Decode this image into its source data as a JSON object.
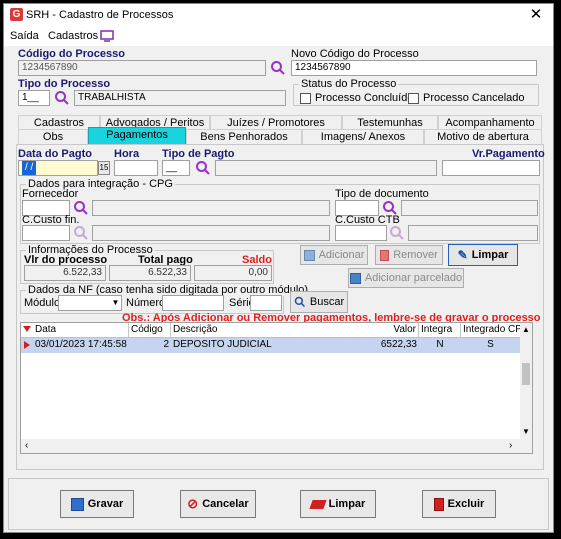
{
  "window": {
    "title": "SRH - Cadastro de Processos"
  },
  "menu": {
    "saida": "Saída",
    "cadastros": "Cadastros"
  },
  "header": {
    "codigo_label": "Código do Processo",
    "codigo_value": "1234567890",
    "novo_codigo_label": "Novo Código do Processo",
    "novo_codigo_value": "1234567890",
    "tipo_label": "Tipo do Processo",
    "tipo_code": "1__",
    "tipo_desc": "TRABALHISTA",
    "status_label": "Status do Processo",
    "concluido_label": "Processo Concluído",
    "cancelado_label": "Processo Cancelado"
  },
  "tabs": {
    "row1": [
      "Cadastros",
      "Advogados / Peritos",
      "Juízes / Promotores",
      "Testemunhas",
      "Acompanhamento"
    ],
    "row2": [
      "Obs",
      "Pagamentos",
      "Bens Penhorados",
      "Imagens/ Anexos",
      "Motivo de abertura"
    ],
    "active": "Pagamentos"
  },
  "pagamento": {
    "data_label": "Data do Pagto",
    "data_value": "/ /",
    "cal_label": "15",
    "hora_label": "Hora",
    "tipo_label": "Tipo de Pagto",
    "tipo_value": "__",
    "vr_label": "Vr.Pagamento",
    "cpg_group": "Dados para integração - CPG",
    "fornecedor_label": "Fornecedor",
    "tipo_doc_label": "Tipo de documento",
    "ccusto_fin_label": "C.Custo fin.",
    "ccusto_ctb_label": "C.Custo CTB"
  },
  "info": {
    "group": "Informações do Processo",
    "vlr_label": "Vlr do processo",
    "vlr_value": "6.522,33",
    "total_label": "Total pago",
    "total_value": "6.522,33",
    "saldo_label": "Saldo",
    "saldo_value": "0,00"
  },
  "actions": {
    "adicionar": "Adicionar",
    "remover": "Remover",
    "limpar": "Limpar",
    "adicionar_parcelado": "Adicionar parcelado"
  },
  "nf": {
    "group": "Dados da NF (caso tenha sido digitada por outro módulo)",
    "modulo_label": "Módulo",
    "numero_label": "Número",
    "serie_label": "Série",
    "buscar": "Buscar"
  },
  "warning": "Obs.: Após Adicionar ou Remover pagamentos, lembre-se de gravar o processo",
  "grid": {
    "columns": [
      "Data",
      "Código",
      "Descrição",
      "Valor",
      "Integra",
      "Integrado CPG"
    ],
    "rows": [
      {
        "data": "03/01/2023 17:45:58",
        "codigo": "2",
        "descricao": "DEPOSITO JUDICIAL",
        "valor": "6522,33",
        "integra": "N",
        "integrado": "S"
      }
    ]
  },
  "footer": {
    "gravar": "Gravar",
    "cancelar": "Cancelar",
    "limpar": "Limpar",
    "excluir": "Excluir"
  },
  "colors": {
    "accent": "#18d4df",
    "label": "#1a1a6e",
    "saldo": "#e02020",
    "warning": "#e02020",
    "selected_row": "#c6d4f0"
  }
}
